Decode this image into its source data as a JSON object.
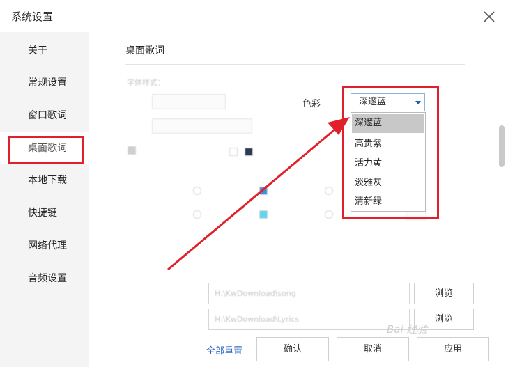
{
  "window": {
    "title": "系统设置"
  },
  "sidebar": {
    "items": [
      {
        "label": "关于"
      },
      {
        "label": "常规设置"
      },
      {
        "label": "窗口歌词"
      },
      {
        "label": "桌面歌词"
      },
      {
        "label": "本地下载"
      },
      {
        "label": "快捷键"
      },
      {
        "label": "网络代理"
      },
      {
        "label": "音频设置"
      }
    ],
    "active_index": 3
  },
  "desktop_lyrics": {
    "section_title": "桌面歌词",
    "font_style_label": "字体样式：",
    "color_label": "色彩",
    "color_select": {
      "selected": "深邃蓝",
      "options": [
        "深邃蓝",
        "高贵紫",
        "活力黄",
        "淡雅灰",
        "清新绿"
      ]
    }
  },
  "download": {
    "path_value": "H:\\KwDownload\\song",
    "lyrics_path_value": "H:\\KwDownload\\Lyrics",
    "browse_label": "浏览"
  },
  "footer": {
    "reset_label": "全部重置",
    "confirm_label": "确认",
    "cancel_label": "取消",
    "apply_label": "应用"
  },
  "annotation_color": "#e0202a",
  "watermark": {
    "text": "Bai 经验"
  }
}
